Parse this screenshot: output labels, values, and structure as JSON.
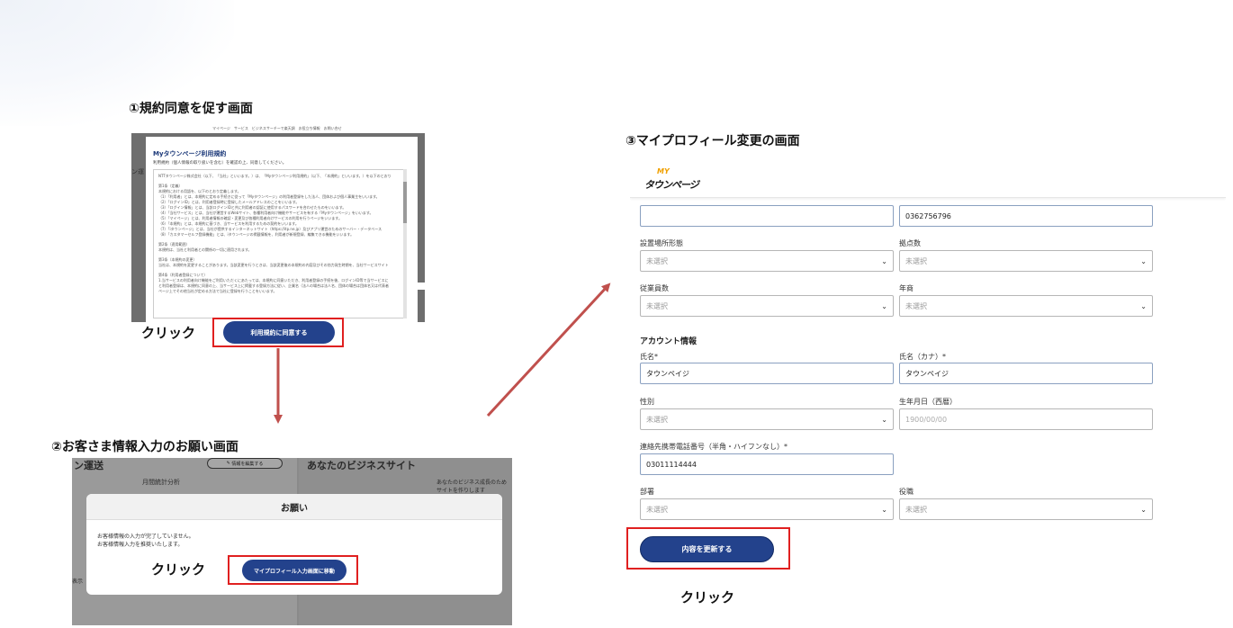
{
  "steps": {
    "step1_title": "①規約同意を促す画面",
    "step2_title": "②お客さま情報入力のお願い画面",
    "step3_title": "③マイプロフィール変更の画面",
    "click": "クリック"
  },
  "shot1": {
    "nav_items": "マイページ　サービス　ビジネスサーチーで楽天調　お役立ち情報　お問い合せ",
    "side_left": "ン運",
    "modal_title": "Myタウンページ利用規約",
    "modal_subtitle": "利用規約（個人情報の取り扱いを含む）を確認の上、同意してください。",
    "terms": [
      "NTTタウンページ株式会社（以下、「当社」といいます。）は、「Myタウンページ利用規約」（以下、「本規約」といいます。）を以下のとおり",
      "",
      "第1条（定義）",
      "本規約における用語を、以下のとおり定義します。",
      "（1）「利用者」とは、本規約に定める手続きに従って「Myタウンページ」の利用者登録をした法人、団体および個人事業主をいいます。",
      "（2）「ログインID」とは、利用者登録時に登録したメールアドレスのことをいいます。",
      "（3）「ログイン情報」とは、当該ログインIDと共に利用者の認証に使用するパスワードを合わせたものをいいます。",
      "（4）「当社サービス」とは、当社が運営するWebサイト、各種利用者向け機能やサービスを有する「Myタウンページ」をいいます。",
      "（5）「マイページ」とは、利用者情報の確認・変更及び各種利用者向けサービスの利用を行うページをいいます。",
      "（6）「本規約」とは、本規約に基づき、当サービスを利用するための契約をいいます。",
      "（7）「iタウンページ」とは、当社が提供するインターネットサイト（https://itp.ne.jp）及びアプリ運営のためのサーバー・データベース",
      "（8）「カスタマーセルフ登録機能」とは、iタウンページの掲載情報を、利用者が新規登録、編集できる機能をいいます。",
      "",
      "第2条（適用範囲）",
      "本規約は、当社と利用者との関係の一切に適用されます。",
      "",
      "第3条（本規約の変更）",
      "当社は、本規約を変更することがあります。当該変更を行うときは、当該変更後の本規約の内容及びその効力発生時期を、当社サービスサイト",
      "",
      "第4条（利用者登録について）",
      "1.当サービスの利用者向け機能をご利用いただくにあたっては、本規約に同意いただき、利用者登録の手続を後、ログインID等で当サービスに",
      "と利用者登録は、本規約に同意の上、当サービス上に掲載する登録方法に従い、企業名（法人の場合は法人名、団体の場合は団体名又は代表者",
      "ページ上でその他当社が定める方法で当社に登録を行うことをいいます。"
    ],
    "agree_button": "利用規約に同意する"
  },
  "shot2": {
    "bg_left_title": "ン運送",
    "bg_left_sub": "月間統計分析",
    "edit_button": "情報を編集する",
    "bg_right_title": "あなたのビジネスサイト",
    "bg_right_text1": "あなたのビジネス成長のため",
    "bg_right_text2": "サイトを作りします",
    "bg_bottom_left": "表示",
    "dialog_title": "お願い",
    "message_line1": "お客様情報の入力が完了していません。",
    "message_line2": "お客様情報入力を推奨いたします。",
    "move_button": "マイプロフィール入力画面に移動"
  },
  "shot3": {
    "logo_my": "MY",
    "logo_text": "タウンページ",
    "top_field_left_value": "",
    "top_field_right_value": "0362756796",
    "fields": {
      "install_type_label": "設置場所形態",
      "install_type_value": "未選択",
      "locations_label": "拠点数",
      "locations_value": "未選択",
      "employees_label": "従業員数",
      "employees_value": "未選択",
      "annual_sales_label": "年商",
      "annual_sales_value": "未選択",
      "account_section": "アカウント情報",
      "name_label": "氏名*",
      "name_value": "タウンペイジ",
      "name_kana_label": "氏名（カナ）*",
      "name_kana_value": "タウンペイジ",
      "gender_label": "性別",
      "gender_value": "未選択",
      "birthday_label": "生年月日（西暦）",
      "birthday_placeholder": "1900/00/00",
      "mobile_label": "連絡先携帯電話番号（半角・ハイフンなし）*",
      "mobile_value": "03011114444",
      "department_label": "部署",
      "department_value": "未選択",
      "position_label": "役職",
      "position_value": "未選択"
    },
    "update_button": "内容を更新する"
  },
  "colors": {
    "navy": "#23428c",
    "highlight_red": "#e02020",
    "arrow": "#c0504d"
  }
}
